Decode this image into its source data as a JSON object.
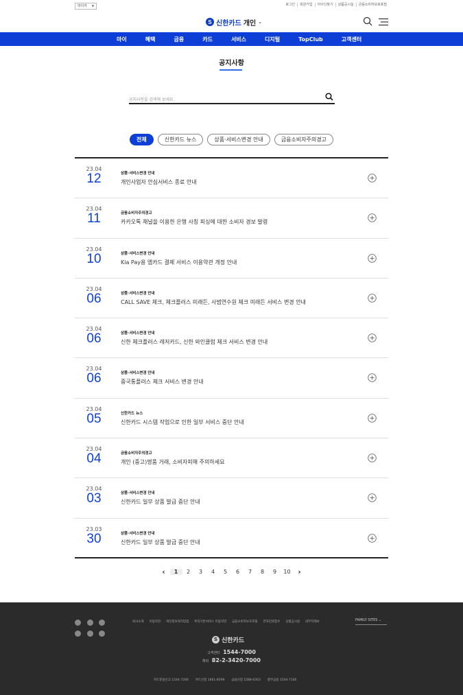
{
  "util": {
    "lang": "마이카",
    "links": [
      "로그인",
      "회원가입",
      "아이디찾기",
      "상품공시실",
      "금융소비자보호포털"
    ]
  },
  "header": {
    "logo_mark": "S",
    "logo_text": "신한카드",
    "logo_sub": "개인",
    "chevron": "⌄",
    "search_icon": "search-icon",
    "menu_icon": "hamburger-menu-icon"
  },
  "gnb": {
    "color": "#0d3fd6",
    "items": [
      "마이",
      "혜택",
      "금융",
      "카드",
      "서비스",
      "디지털",
      "TopClub",
      "고객센터"
    ]
  },
  "page": {
    "title": "공지사항",
    "search_placeholder": "공지사항을 검색해 보세요."
  },
  "tabs": [
    {
      "label": "전체",
      "active": true
    },
    {
      "label": "신한카드 뉴스",
      "active": false
    },
    {
      "label": "상품·서비스변경 안내",
      "active": false
    },
    {
      "label": "금융소비자주의경고",
      "active": false
    }
  ],
  "notices": [
    {
      "ym": "23.04",
      "day": "12",
      "category": "상품·서비스변경 안내",
      "subject": "개인사업자 안심서비스 종료 안내"
    },
    {
      "ym": "23.04",
      "day": "11",
      "category": "금융소비자주의경고",
      "subject": "카카오톡 채널을 이용한 은행 사칭 피싱에 대한 소비자 경보 발령"
    },
    {
      "ym": "23.04",
      "day": "10",
      "category": "상품·서비스변경 안내",
      "subject": "Kia Pay용 앱카드 결제 서비스 이용약관 개정 안내"
    },
    {
      "ym": "23.04",
      "day": "06",
      "category": "상품·서비스변경 안내",
      "subject": "CALL SAVE 체크, 체크플러스 미래든, 사범연수원 체크 미래든 서비스 변경 안내"
    },
    {
      "ym": "23.04",
      "day": "06",
      "category": "상품·서비스변경 안내",
      "subject": "신한 체크플러스 레저카드, 신한 와인클럽 체크 서비스 변경 안내"
    },
    {
      "ym": "23.04",
      "day": "06",
      "category": "상품·서비스변경 안내",
      "subject": "중국통플러스 체크 서비스 변경 안내"
    },
    {
      "ym": "23.04",
      "day": "05",
      "category": "신한카드 뉴스",
      "subject": "신한카드 시스템 작업으로 인한 일부 서비스 중단 안내"
    },
    {
      "ym": "23.04",
      "day": "04",
      "category": "금융소비자주의경고",
      "subject": "개인 (중고)명품 거래, 소비자피해 주의하세요"
    },
    {
      "ym": "23.04",
      "day": "03",
      "category": "상품·서비스변경 안내",
      "subject": "신한카드 일부 상품 발급 중단 안내"
    },
    {
      "ym": "23.03",
      "day": "30",
      "category": "상품·서비스변경 안내",
      "subject": "신한카드 일부 상품 발급 중단 안내"
    }
  ],
  "pager": {
    "prev": "‹",
    "next": "›",
    "pages": [
      "1",
      "2",
      "3",
      "4",
      "5",
      "6",
      "7",
      "8",
      "9",
      "10"
    ],
    "current": "1"
  },
  "footer": {
    "links": [
      "회사소개",
      "이용약관",
      "개인정보처리방침",
      "위치기반서비스 이용약관",
      "금융소비자보호포털",
      "전자민원접수",
      "상품공시실",
      "내부자제보"
    ],
    "family_sites": "FAMILY SITES ⌄",
    "logo_mark": "S",
    "logo_text": "신한카드",
    "cs_label": "고객센터",
    "cs_number": "1544-7000",
    "overseas_label": "해외",
    "overseas_number": "82-2-3420-7000",
    "bottom": [
      "카드분실신고 1544-7200",
      "카드신청 1661-8599",
      "금융신청 1588-0303",
      "할부금융 1544-7100"
    ]
  }
}
